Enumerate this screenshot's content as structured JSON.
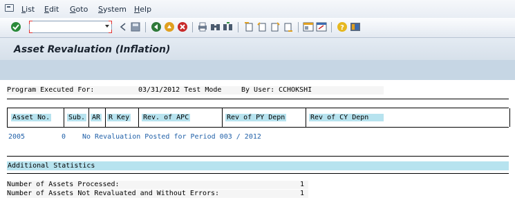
{
  "menu": {
    "items": [
      "List",
      "Edit",
      "Goto",
      "System",
      "Help"
    ]
  },
  "command_field": {
    "value": ""
  },
  "toolbar": {
    "icons": [
      "enter-icon",
      "back-icon",
      "save-icon",
      "back-nav-icon",
      "exit-icon",
      "cancel-icon",
      "print-icon",
      "find-icon",
      "find-next-icon",
      "first-page-icon",
      "previous-page-icon",
      "next-page-icon",
      "last-page-icon",
      "create-session-icon",
      "shortcut-icon",
      "help-icon",
      "customize-layout-icon"
    ]
  },
  "title": "Asset Revaluation (Inflation)",
  "report": {
    "program_label": "Program Executed For:",
    "program_value": "03/31/2012 Test Mode",
    "by_user_label": "By User:",
    "by_user_value": "CCHOKSHI",
    "columns": [
      "Asset No.",
      "Sub.",
      "AR",
      "R Key",
      "Rev. of APC",
      "Rev of PY Depn",
      "Rev of CY Depn"
    ],
    "rows": [
      {
        "asset_no": "2005",
        "sub": "0",
        "message": "No Revaluation Posted for Period 003 / 2012"
      }
    ],
    "additional_statistics": "Additional Statistics",
    "stats": [
      {
        "label": "Number of Assets Processed:",
        "value": "1"
      },
      {
        "label": "Number of Assets Not Revaluated and Without Errors:",
        "value": "1"
      }
    ]
  }
}
